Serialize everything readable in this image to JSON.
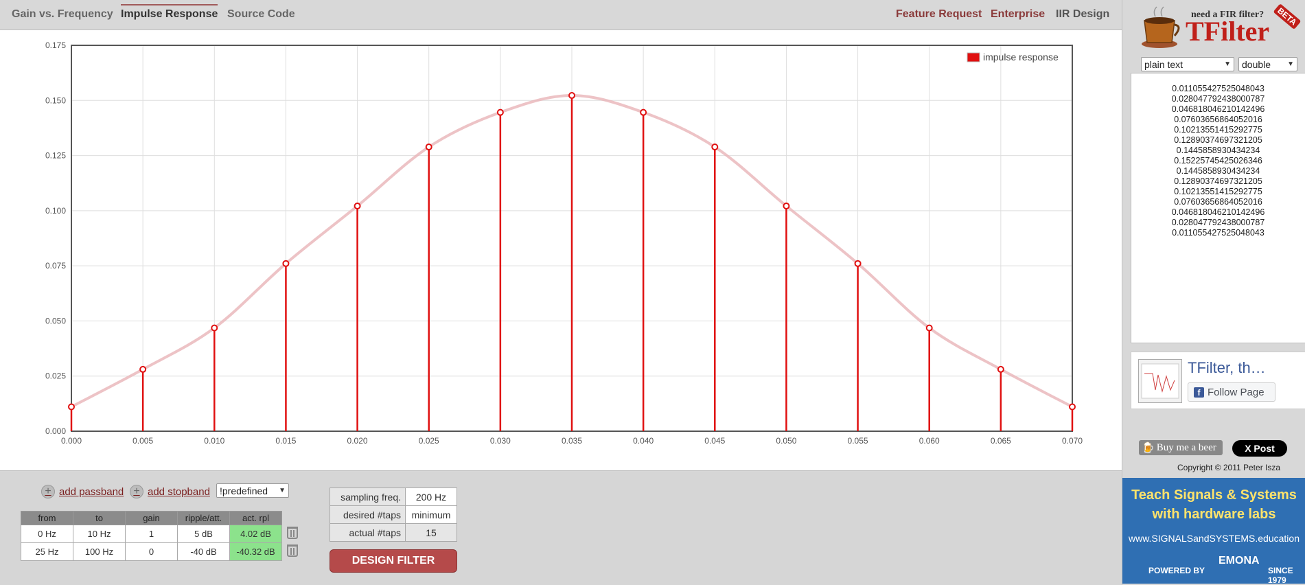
{
  "nav": {
    "tabs": [
      {
        "label": "Gain vs. Frequency",
        "active": false
      },
      {
        "label": "Impulse Response",
        "active": true
      },
      {
        "label": "Source Code",
        "active": false
      }
    ],
    "links": [
      "Feature Request",
      "Enterprise",
      "IIR Design"
    ]
  },
  "chart_data": {
    "type": "line",
    "legend": "impulse response",
    "legend_position": "top-right",
    "x": [
      0.0,
      0.005,
      0.01,
      0.015,
      0.02,
      0.025,
      0.03,
      0.035,
      0.04,
      0.045,
      0.05,
      0.055,
      0.06,
      0.065,
      0.07
    ],
    "values": [
      0.011055427525048043,
      0.028047792438000787,
      0.046818046210142496,
      0.07603656864052016,
      0.10213551415292775,
      0.12890374697321205,
      0.1445858930434234,
      0.15225745425026346,
      0.1445858930434234,
      0.12890374697321205,
      0.10213551415292775,
      0.07603656864052016,
      0.046818046210142496,
      0.028047792438000787,
      0.011055427525048043
    ],
    "xlim": [
      0,
      0.07
    ],
    "ylim": [
      0,
      0.175
    ],
    "xticks": [
      "0.000",
      "0.005",
      "0.010",
      "0.015",
      "0.020",
      "0.025",
      "0.030",
      "0.035",
      "0.040",
      "0.045",
      "0.050",
      "0.055",
      "0.060",
      "0.065",
      "0.070"
    ],
    "yticks": [
      "0.000",
      "0.025",
      "0.050",
      "0.075",
      "0.100",
      "0.125",
      "0.150",
      "0.175"
    ],
    "grid": true,
    "color": "#e01010"
  },
  "right": {
    "logo_small": "need a FIR filter?",
    "logo_big": "TFilter",
    "logo_badge": "BETA",
    "format_select": "plain text",
    "type_select": "double",
    "coefficients": [
      "0.011055427525048043",
      "0.028047792438000787",
      "0.046818046210142496",
      "0.07603656864052016",
      "0.10213551415292775",
      "0.12890374697321205",
      "0.1445858930434234",
      "0.15225745425026346",
      "0.1445858930434234",
      "0.12890374697321205",
      "0.10213551415292775",
      "0.07603656864052016",
      "0.046818046210142496",
      "0.028047792438000787",
      "0.011055427525048043"
    ],
    "fb_title": "TFilter, th…",
    "fb_follow": "Follow Page",
    "beer": "Buy me a beer",
    "xpost": "X Post",
    "copyright": "Copyright © 2011 Peter Isza",
    "ad": {
      "line1": "Teach Signals & Systems",
      "line2": "with hardware labs",
      "url": "www.SIGNALSandSYSTEMS.education",
      "powered": "POWERED BY",
      "brand": "EMONA",
      "since": "SINCE 1979"
    }
  },
  "controls": {
    "add_passband": "add passband",
    "add_stopband": "add stopband",
    "predefined": "!predefined",
    "band_headers": [
      "from",
      "to",
      "gain",
      "ripple/att.",
      "act. rpl"
    ],
    "bands": [
      [
        "0 Hz",
        "10 Hz",
        "1",
        "5 dB",
        "4.02 dB"
      ],
      [
        "25 Hz",
        "100 Hz",
        "0",
        "-40 dB",
        "-40.32 dB"
      ]
    ],
    "params": {
      "sampling_label": "sampling freq.",
      "sampling_value": "200 Hz",
      "desired_label": "desired #taps",
      "desired_value": "minimum",
      "actual_label": "actual #taps",
      "actual_value": "15"
    },
    "design_button": "DESIGN FILTER"
  },
  "colors": {
    "accent": "#b54a4a",
    "link": "#7a1e1e",
    "series": "#e01010",
    "ok": "#8ce28c"
  }
}
